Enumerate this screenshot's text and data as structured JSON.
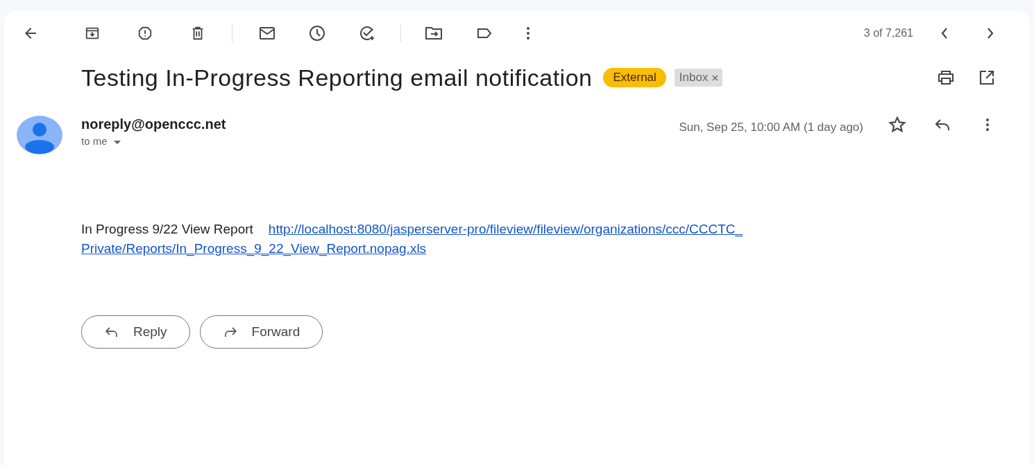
{
  "pager": {
    "counter": "3 of 7,261"
  },
  "subject": "Testing In-Progress Reporting email notification",
  "labels": [
    {
      "text": "External",
      "kind": "external",
      "removable": false
    },
    {
      "text": "Inbox",
      "kind": "folder",
      "removable": true
    }
  ],
  "message": {
    "sender": "noreply@openccc.net",
    "recipient": "to me",
    "date": "Sun, Sep 25, 10:00 AM (1 day ago)",
    "starred": false
  },
  "body": {
    "text": "In Progress 9/22 View Report",
    "link_lines": [
      "http://localhost:8080/jasperserver-pro/fileview/fileview/organizations/ccc/CCCTC_",
      "Private/Reports/In_Progress_9_22_View_Report.nopag.xls"
    ]
  },
  "actions": [
    {
      "label": "Reply",
      "kind": "reply"
    },
    {
      "label": "Forward",
      "kind": "forward"
    }
  ]
}
